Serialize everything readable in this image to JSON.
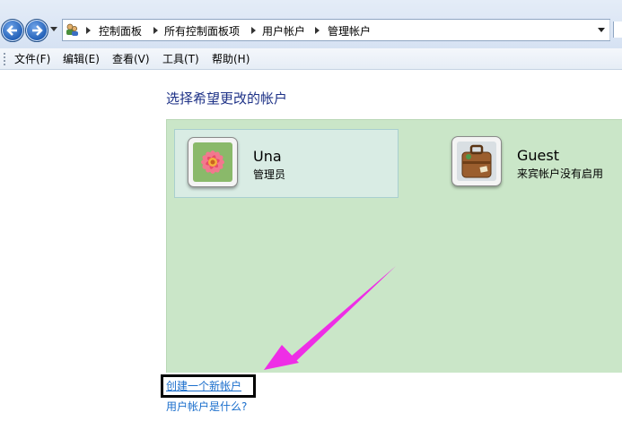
{
  "address": {
    "breadcrumbs": [
      "控制面板",
      "所有控制面板项",
      "用户帐户",
      "管理帐户"
    ]
  },
  "menu": [
    "文件(F)",
    "编辑(E)",
    "查看(V)",
    "工具(T)",
    "帮助(H)"
  ],
  "main": {
    "heading": "选择希望更改的帐户",
    "accounts": [
      {
        "name": "Una",
        "role": "管理员",
        "icon": "flower-avatar-icon"
      },
      {
        "name": "Guest",
        "role": "来宾帐户没有启用",
        "icon": "suitcase-avatar-icon"
      }
    ],
    "links": {
      "create": "创建一个新帐户",
      "what": "用户帐户是什么?"
    }
  },
  "colors": {
    "panel": "#cae6c8",
    "link": "#1a6ecc",
    "heading": "#1e3287",
    "annotation_arrow": "#ee2ee6"
  }
}
